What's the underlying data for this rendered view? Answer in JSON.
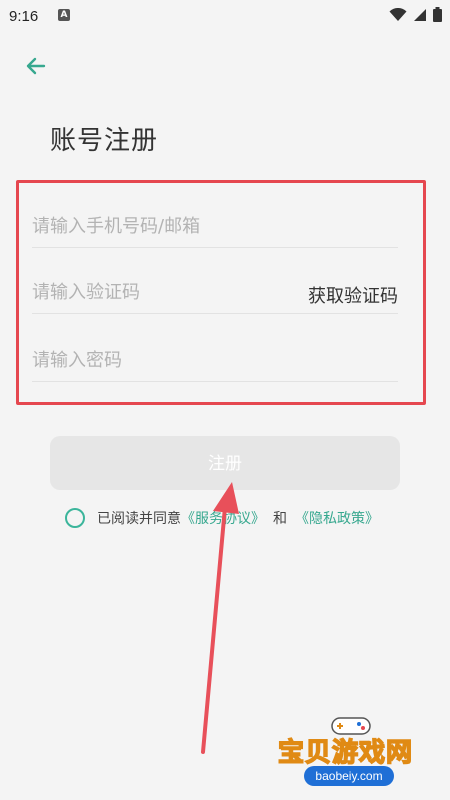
{
  "status_bar": {
    "time": "9:16",
    "notification_icon_text": "A",
    "icons": [
      "wifi-icon",
      "signal-icon",
      "battery-icon"
    ]
  },
  "header": {
    "back_icon": "arrow-left-icon"
  },
  "page": {
    "title": "账号注册"
  },
  "form": {
    "phone_placeholder": "请输入手机号码/邮箱",
    "code_placeholder": "请输入验证码",
    "get_code_label": "获取验证码",
    "password_placeholder": "请输入密码"
  },
  "register_button": {
    "label": "注册"
  },
  "agreement": {
    "prefix": "已阅读并同意",
    "service_link": "《服务协议》",
    "conjunction": "和",
    "privacy_link": "《隐私政策》"
  },
  "watermark": {
    "title": "宝贝游戏网",
    "url": "baobeiy.com"
  },
  "colors": {
    "accent": "#37a88f",
    "highlight_border": "#e5474f",
    "button_disabled": "#e6e6e6",
    "background": "#f4f4f4"
  }
}
